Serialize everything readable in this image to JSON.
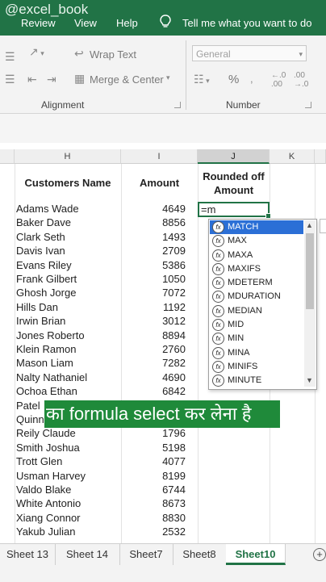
{
  "watermark": "@excel_book",
  "menu": {
    "review": "Review",
    "view": "View",
    "help": "Help",
    "tell_me": "Tell me what you want to do"
  },
  "ribbon": {
    "wrap_text": "Wrap Text",
    "merge_center": "Merge & Center",
    "number_format": "General",
    "alignment_label": "Alignment",
    "number_label": "Number",
    "currency_symbol": "%"
  },
  "columns": [
    "H",
    "I",
    "J",
    "K"
  ],
  "headers": {
    "customers_name": "Customers Name",
    "amount": "Amount",
    "rounded_off_1": "Rounded off",
    "rounded_off_2": "Amount"
  },
  "rows": [
    {
      "name": "Adams Wade",
      "amount": "4649"
    },
    {
      "name": "Baker Dave",
      "amount": "8856"
    },
    {
      "name": "Clark Seth",
      "amount": "1493"
    },
    {
      "name": "Davis Ivan",
      "amount": "2709"
    },
    {
      "name": "Evans Riley",
      "amount": "5386"
    },
    {
      "name": "Frank Gilbert",
      "amount": "1050"
    },
    {
      "name": "Ghosh Jorge",
      "amount": "7072"
    },
    {
      "name": "Hills Dan",
      "amount": "1192"
    },
    {
      "name": "Irwin Brian",
      "amount": "3012"
    },
    {
      "name": "Jones Roberto",
      "amount": "8894"
    },
    {
      "name": "Klein Ramon",
      "amount": "2760"
    },
    {
      "name": "Mason Liam",
      "amount": "7282"
    },
    {
      "name": "Nalty Nathaniel",
      "amount": "4690"
    },
    {
      "name": "Ochoa Ethan",
      "amount": "6842"
    },
    {
      "name": "Patel",
      "amount": ""
    },
    {
      "name": "Quinn",
      "amount": ""
    },
    {
      "name": "Reily Claude",
      "amount": "1796"
    },
    {
      "name": "Smith Joshua",
      "amount": "5198"
    },
    {
      "name": "Trott Glen",
      "amount": "4077"
    },
    {
      "name": "Usman Harvey",
      "amount": "8199"
    },
    {
      "name": "Valdo Blake",
      "amount": "6744"
    },
    {
      "name": "White Antonio",
      "amount": "8673"
    },
    {
      "name": "Xiang Connor",
      "amount": "8830"
    },
    {
      "name": "Yakub Julian",
      "amount": "2532"
    }
  ],
  "active_cell_value": "=m",
  "autocomplete": [
    "MATCH",
    "MAX",
    "MAXA",
    "MAXIFS",
    "MDETERM",
    "MDURATION",
    "MEDIAN",
    "MID",
    "MIN",
    "MINA",
    "MINIFS",
    "MINUTE"
  ],
  "caption": "का formula select कर लेना है",
  "sheet_tabs": [
    "Sheet 13",
    "Sheet 14",
    "Sheet7",
    "Sheet8",
    "Sheet10"
  ],
  "active_sheet": "Sheet10",
  "colors": {
    "excel_green": "#217346",
    "caption_bg": "#1f8a3a",
    "selection_blue": "#2b6fd6"
  }
}
